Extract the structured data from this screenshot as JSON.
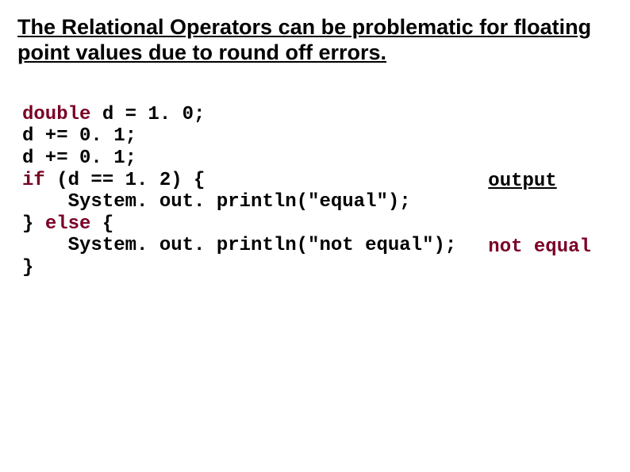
{
  "title": "The Relational Operators can be problematic for floating point values due to round off errors.",
  "code": {
    "kw_double": "double",
    "l1_rest": " d = 1. 0;",
    "l2": "d += 0. 1;",
    "l3": "d += 0. 1;",
    "kw_if": "if",
    "l4_rest": " (d == 1. 2) {",
    "l5": "    System. out. println(\"equal\");",
    "l6a": "} ",
    "kw_else": "else",
    "l6b": " {",
    "l7": "    System. out. println(\"not equal\");",
    "l8": "}"
  },
  "output": {
    "heading": "output",
    "value": "not equal"
  }
}
